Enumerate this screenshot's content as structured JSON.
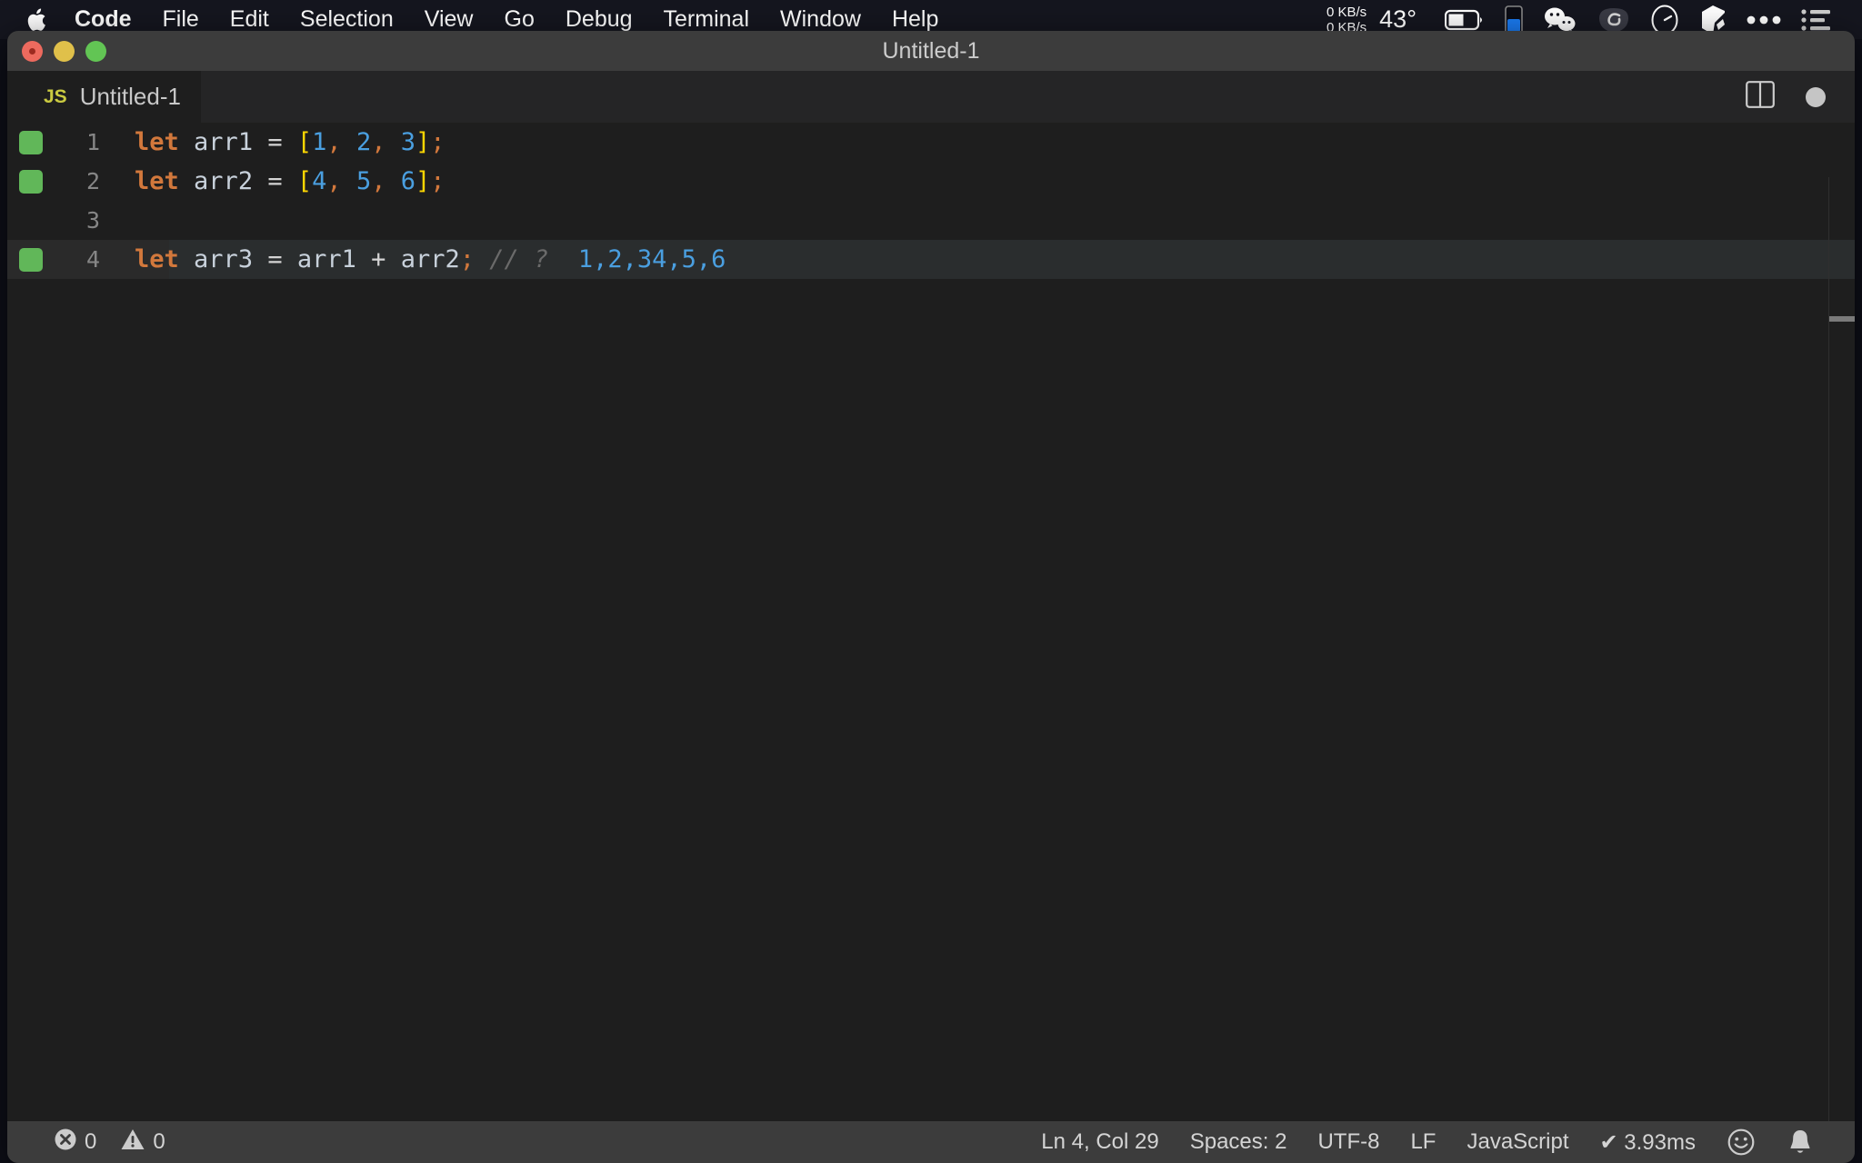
{
  "menubar": {
    "apple_icon": "apple-logo",
    "items": [
      {
        "label": "Code",
        "bold": true
      },
      {
        "label": "File",
        "bold": false
      },
      {
        "label": "Edit",
        "bold": false
      },
      {
        "label": "Selection",
        "bold": false
      },
      {
        "label": "View",
        "bold": false
      },
      {
        "label": "Go",
        "bold": false
      },
      {
        "label": "Debug",
        "bold": false
      },
      {
        "label": "Terminal",
        "bold": false
      },
      {
        "label": "Window",
        "bold": false
      },
      {
        "label": "Help",
        "bold": false
      }
    ],
    "network_up": "0 KB/s",
    "network_down": "0 KB/s",
    "temperature": "43°",
    "tray_icons": [
      "battery-icon",
      "blue-gauge-icon",
      "wechat-icon",
      "spiral-app-icon",
      "speedometer-icon",
      "cube-icon",
      "ellipsis-icon",
      "control-center-icon"
    ]
  },
  "window": {
    "title": "Untitled-1",
    "traffic_lights": [
      "close-button",
      "minimize-button",
      "maximize-button"
    ]
  },
  "tab": {
    "badge": "JS",
    "label": "Untitled-1",
    "split_editor_label": "split-editor",
    "dirty_indicator": "unsaved-changes"
  },
  "editor": {
    "language": "javascript",
    "lines": [
      {
        "num": "1",
        "quokka": true,
        "active": false,
        "tokens": [
          {
            "t": "let",
            "c": "t-kw"
          },
          {
            "t": " ",
            "c": "t-op"
          },
          {
            "t": "arr1",
            "c": "t-var"
          },
          {
            "t": " ",
            "c": "t-op"
          },
          {
            "t": "=",
            "c": "t-op"
          },
          {
            "t": " ",
            "c": "t-op"
          },
          {
            "t": "[",
            "c": "t-br"
          },
          {
            "t": "1",
            "c": "t-num"
          },
          {
            "t": ",",
            "c": "t-pn"
          },
          {
            "t": " ",
            "c": "t-op"
          },
          {
            "t": "2",
            "c": "t-num"
          },
          {
            "t": ",",
            "c": "t-pn"
          },
          {
            "t": " ",
            "c": "t-op"
          },
          {
            "t": "3",
            "c": "t-num"
          },
          {
            "t": "]",
            "c": "t-br"
          },
          {
            "t": ";",
            "c": "t-pn"
          }
        ]
      },
      {
        "num": "2",
        "quokka": true,
        "active": false,
        "tokens": [
          {
            "t": "let",
            "c": "t-kw"
          },
          {
            "t": " ",
            "c": "t-op"
          },
          {
            "t": "arr2",
            "c": "t-var"
          },
          {
            "t": " ",
            "c": "t-op"
          },
          {
            "t": "=",
            "c": "t-op"
          },
          {
            "t": " ",
            "c": "t-op"
          },
          {
            "t": "[",
            "c": "t-br"
          },
          {
            "t": "4",
            "c": "t-num"
          },
          {
            "t": ",",
            "c": "t-pn"
          },
          {
            "t": " ",
            "c": "t-op"
          },
          {
            "t": "5",
            "c": "t-num"
          },
          {
            "t": ",",
            "c": "t-pn"
          },
          {
            "t": " ",
            "c": "t-op"
          },
          {
            "t": "6",
            "c": "t-num"
          },
          {
            "t": "]",
            "c": "t-br"
          },
          {
            "t": ";",
            "c": "t-pn"
          }
        ]
      },
      {
        "num": "3",
        "quokka": false,
        "active": false,
        "tokens": []
      },
      {
        "num": "4",
        "quokka": true,
        "active": true,
        "tokens": [
          {
            "t": "let",
            "c": "t-kw"
          },
          {
            "t": " ",
            "c": "t-op"
          },
          {
            "t": "arr3",
            "c": "t-var"
          },
          {
            "t": " ",
            "c": "t-op"
          },
          {
            "t": "=",
            "c": "t-op"
          },
          {
            "t": " ",
            "c": "t-op"
          },
          {
            "t": "arr1",
            "c": "t-var"
          },
          {
            "t": " ",
            "c": "t-op"
          },
          {
            "t": "+",
            "c": "t-op"
          },
          {
            "t": " ",
            "c": "t-op"
          },
          {
            "t": "arr2",
            "c": "t-var"
          },
          {
            "t": ";",
            "c": "t-pn"
          },
          {
            "t": " ",
            "c": "t-op"
          },
          {
            "t": "// ?",
            "c": "t-cm"
          },
          {
            "t": "  ",
            "c": "t-op"
          },
          {
            "t": "1,2,34,5,6",
            "c": "t-res"
          }
        ]
      }
    ]
  },
  "statusbar": {
    "error_icon": "error-icon",
    "error_count": "0",
    "warning_icon": "warning-icon",
    "warning_count": "0",
    "cursor_position": "Ln 4, Col 29",
    "indentation": "Spaces: 2",
    "encoding": "UTF-8",
    "eol": "LF",
    "language": "JavaScript",
    "quokka_time": "✔ 3.93ms",
    "feedback_icon": "smiley-icon",
    "notifications_icon": "bell-icon"
  },
  "colors": {
    "accent_green": "#61b759",
    "keyword_orange": "#d2783c",
    "number_blue": "#4a9fe0",
    "bracket_yellow": "#ffd602",
    "js_yellow": "#cbcb41",
    "editor_bg": "#1e1e1e",
    "statusbar_bg": "#3c3c3c"
  }
}
